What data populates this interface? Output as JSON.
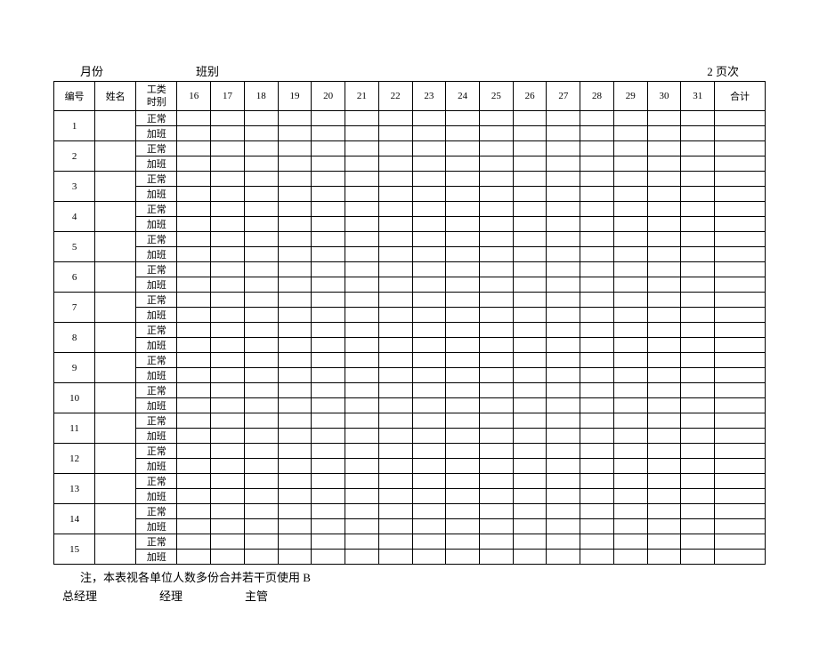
{
  "top": {
    "month_label": "月份",
    "class_label": "班别",
    "page_label": "2 页次"
  },
  "headers": {
    "num": "编号",
    "name": "姓名",
    "type_line1": "工类",
    "type_line2": "时别",
    "days": [
      "16",
      "17",
      "18",
      "19",
      "20",
      "21",
      "22",
      "23",
      "24",
      "25",
      "26",
      "27",
      "28",
      "29",
      "30",
      "31"
    ],
    "total": "合计"
  },
  "row_types": {
    "normal": "正常",
    "overtime": "加班"
  },
  "row_nums": [
    "1",
    "2",
    "3",
    "4",
    "5",
    "6",
    "7",
    "8",
    "9",
    "10",
    "11",
    "12",
    "13",
    "14",
    "15"
  ],
  "footer": {
    "note": "注，本表视各单位人数多份合并若干页使用 B",
    "sig1": "总经理",
    "sig2": "经理",
    "sig3": "主管"
  }
}
